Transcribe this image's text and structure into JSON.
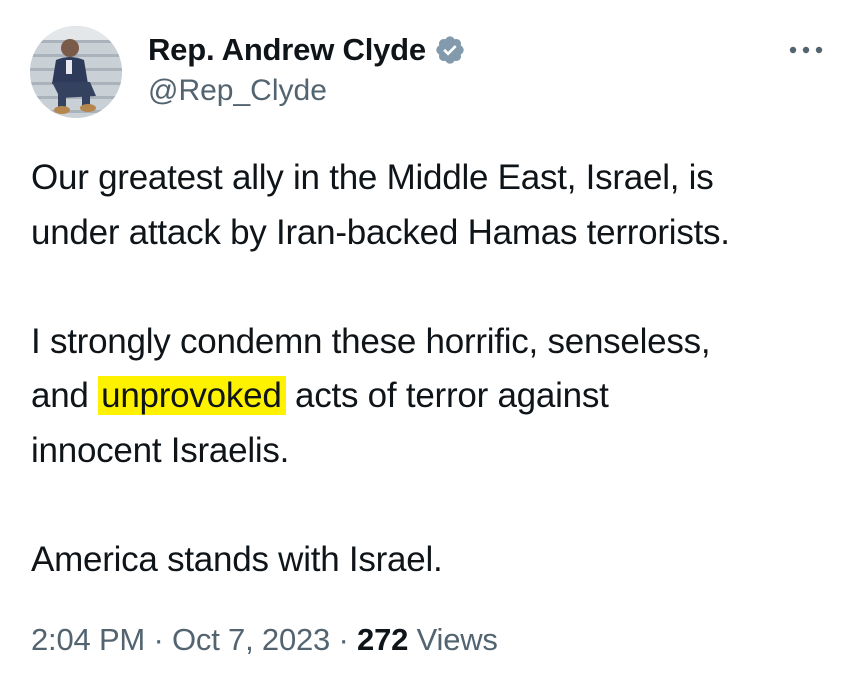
{
  "tweet": {
    "author": {
      "display_name": "Rep. Andrew Clyde",
      "handle": "@Rep_Clyde",
      "verified": true
    },
    "more_icon": "ellipsis-icon",
    "text": {
      "line1_a": "Our greatest ally in the Middle East, Israel, is",
      "line1_b": "under attack by Iran-backed Hamas terrorists.",
      "line2_a": "I strongly condemn these horrific, senseless,",
      "line2_b_pre": "and ",
      "line2_b_highlight": "unprovoked",
      "line2_b_post": " acts of terror against",
      "line2_c": "innocent Israelis.",
      "line3": "America stands with Israel."
    },
    "meta": {
      "time": "2:04 PM",
      "separator1": " · ",
      "date": "Oct 7, 2023",
      "separator2": " · ",
      "views_count": "272",
      "views_label": " Views"
    },
    "colors": {
      "highlight": "#fff200",
      "verified_badge": "#829aab",
      "secondary_text": "#536471",
      "primary_text": "#0f1419"
    }
  }
}
